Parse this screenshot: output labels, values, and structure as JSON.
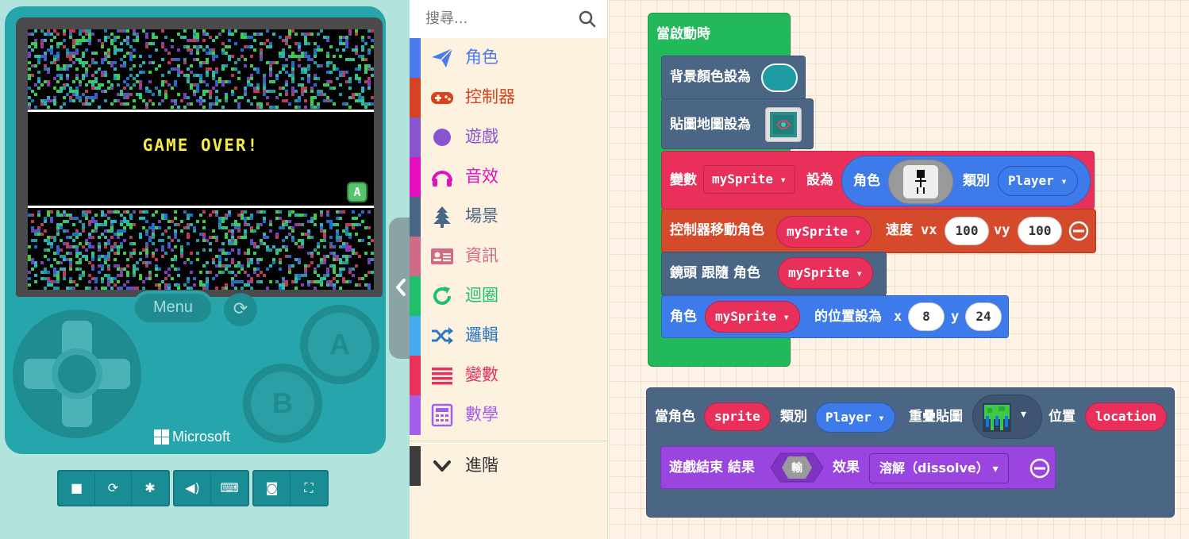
{
  "simulator": {
    "screen_text": "GAME OVER!",
    "corner_badge": "A",
    "menu_label": "Menu",
    "button_a": "A",
    "button_b": "B",
    "brand": "Microsoft",
    "toolbar_icons": [
      "stop-icon",
      "restart-icon",
      "debug-icon",
      "sound-icon",
      "keyboard-icon",
      "screenshot-icon",
      "fullscreen-icon"
    ]
  },
  "toolbox": {
    "search_placeholder": "搜尋...",
    "categories": [
      {
        "label": "角色",
        "color": "#4b7bec",
        "icon": "paper-plane-icon"
      },
      {
        "label": "控制器",
        "color": "#d54322",
        "icon": "gamepad-icon"
      },
      {
        "label": "遊戲",
        "color": "#8854d0",
        "icon": "circle-icon"
      },
      {
        "label": "音效",
        "color": "#e30fc0",
        "icon": "headphones-icon"
      },
      {
        "label": "場景",
        "color": "#4b6584",
        "icon": "tree-icon"
      },
      {
        "label": "資訊",
        "color": "#cf6a87",
        "icon": "id-card-icon"
      },
      {
        "label": "迴圈",
        "color": "#20bf6b",
        "icon": "loop-icon"
      },
      {
        "label": "邏輯",
        "color": "#45aaf2",
        "icon": "shuffle-icon"
      },
      {
        "label": "變數",
        "color": "#e9315c",
        "icon": "list-icon"
      },
      {
        "label": "數學",
        "color": "#a55eea",
        "icon": "calculator-icon"
      }
    ],
    "advanced_label": "進階",
    "advanced_color": "#3c3c3c"
  },
  "workspace": {
    "on_start": {
      "hat_label": "當啟動時",
      "set_bg_label": "背景顏色設為",
      "bg_color": "#1e9ba3",
      "set_tilemap_label": "貼圖地圖設為",
      "var_label": "變數",
      "var_name": "mySprite",
      "set_to": "設為",
      "sprite_label": "角色",
      "kind_label": "類別",
      "kind_value": "Player",
      "controller_label": "控制器移動角色",
      "controller_sprite": "mySprite",
      "speed_label": "速度",
      "vx_label": "vx",
      "vx_value": "100",
      "vy_label": "vy",
      "vy_value": "100",
      "camera_label": "鏡頭 跟隨 角色",
      "camera_sprite": "mySprite",
      "position_sprite_label": "角色",
      "position_sprite": "mySprite",
      "position_label": "的位置設為",
      "x_label": "x",
      "x_value": "8",
      "y_label": "y",
      "y_value": "24"
    },
    "on_overlap": {
      "label": "當角色",
      "sprite_param": "sprite",
      "kind_label": "類別",
      "kind_value": "Player",
      "overlap_label": "重疊貼圖",
      "location_label": "位置",
      "location_param": "location",
      "game_over_label": "遊戲結束 結果",
      "result_value": "輸",
      "effect_label": "效果",
      "effect_value": "溶解（dissolve）"
    }
  }
}
